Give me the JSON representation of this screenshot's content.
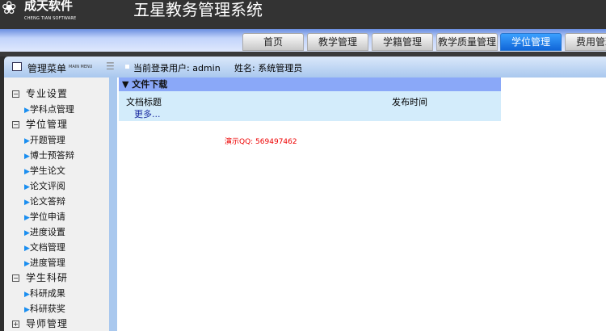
{
  "header": {
    "logo_cn": "成天软件",
    "logo_en": "CHENG TIAN SOFTWARE",
    "title": "五星教务管理系统"
  },
  "tabs": [
    {
      "label": "首页"
    },
    {
      "label": "教学管理"
    },
    {
      "label": "学籍管理"
    },
    {
      "label": "教学质量管理"
    },
    {
      "label": "学位管理",
      "active": true
    },
    {
      "label": "费用管理"
    }
  ],
  "bar": {
    "menu_title": "管理菜单",
    "menu_en": "MAIN MENU",
    "user": "当前登录用户: admin",
    "name": "姓名: 系统管理员"
  },
  "sidebar": {
    "groups": [
      {
        "label": "专业设置",
        "expanded": true,
        "items": [
          "学科点管理"
        ]
      },
      {
        "label": "学位管理",
        "expanded": true,
        "items": [
          "开题管理",
          "博士预答辩",
          "学生论文",
          "论文评阅",
          "论文答辩",
          "学位申请",
          "进度设置",
          "文档管理",
          "进度管理"
        ]
      },
      {
        "label": "学生科研",
        "expanded": true,
        "items": [
          "科研成果",
          "科研获奖"
        ]
      },
      {
        "label": "导师管理",
        "expanded": false,
        "items": []
      }
    ]
  },
  "panel": {
    "title": "文件下载",
    "col_title": "文档标题",
    "col_time": "发布时间",
    "more": "更多..."
  },
  "notice": "演示QQ: 569497462"
}
